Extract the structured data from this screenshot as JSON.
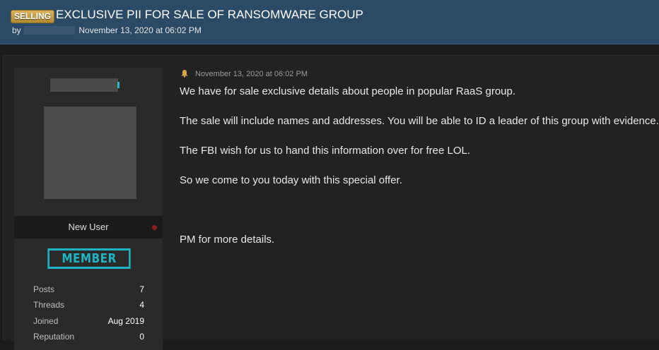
{
  "thread": {
    "prefix": "SELLING",
    "title": "EXCLUSIVE PII FOR SALE OF RANSOMWARE GROUP",
    "by_label": "by",
    "date": "November 13, 2020 at 06:02 PM"
  },
  "user": {
    "title": "New User",
    "rank": "MEMBER",
    "stats": [
      {
        "label": "Posts",
        "value": "7"
      },
      {
        "label": "Threads",
        "value": "4"
      },
      {
        "label": "Joined",
        "value": "Aug 2019"
      },
      {
        "label": "Reputation",
        "value": "0"
      }
    ]
  },
  "post": {
    "date": "November 13, 2020 at 06:02 PM",
    "paragraphs": [
      "We have for sale exclusive details about people in popular RaaS group.",
      "The sale will include names and addresses. You will be able to ID a leader of this group with evidence.",
      "The FBI wish for us to hand this information over for free LOL.",
      "So we come to you today with this special offer.",
      "PM for more details."
    ]
  },
  "colors": {
    "header_bg": "#2b4a66",
    "badge_gold": "#c9a04a",
    "rank_teal": "#1db5c4",
    "status_offline": "#8b1d1d"
  },
  "icons": {
    "post_date_icon": "bell-icon"
  }
}
